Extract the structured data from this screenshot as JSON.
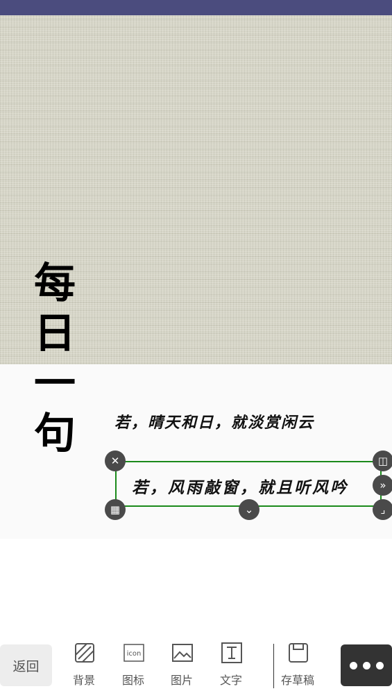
{
  "canvas": {
    "vertical_title": "每日一句",
    "poem_line_1": "若，晴天和日，就淡赏闲云",
    "poem_line_2": "若，风雨敲窗，就且听风吟"
  },
  "selection_handles": [
    {
      "name": "delete-icon",
      "glyph": "✕"
    },
    {
      "name": "flip-icon",
      "glyph": "◫"
    },
    {
      "name": "forward-icon",
      "glyph": "»"
    },
    {
      "name": "opacity-icon",
      "glyph": "▦"
    },
    {
      "name": "chevron-down-icon",
      "glyph": "⌄"
    },
    {
      "name": "resize-icon",
      "glyph": "⌟"
    }
  ],
  "toolbar": {
    "back_label": "返回",
    "items": [
      {
        "label": "背景",
        "icon": "background-icon"
      },
      {
        "label": "图标",
        "icon": "icon-library-icon",
        "icon_text": "icon"
      },
      {
        "label": "图片",
        "icon": "image-icon"
      },
      {
        "label": "文字",
        "icon": "text-icon"
      },
      {
        "label": "存草稿",
        "icon": "save-draft-icon"
      }
    ],
    "more_icon": "more-icon"
  },
  "colors": {
    "status_bar": "#4b4c7e",
    "selection_border": "#1a8a1a",
    "more_button": "#333333"
  }
}
